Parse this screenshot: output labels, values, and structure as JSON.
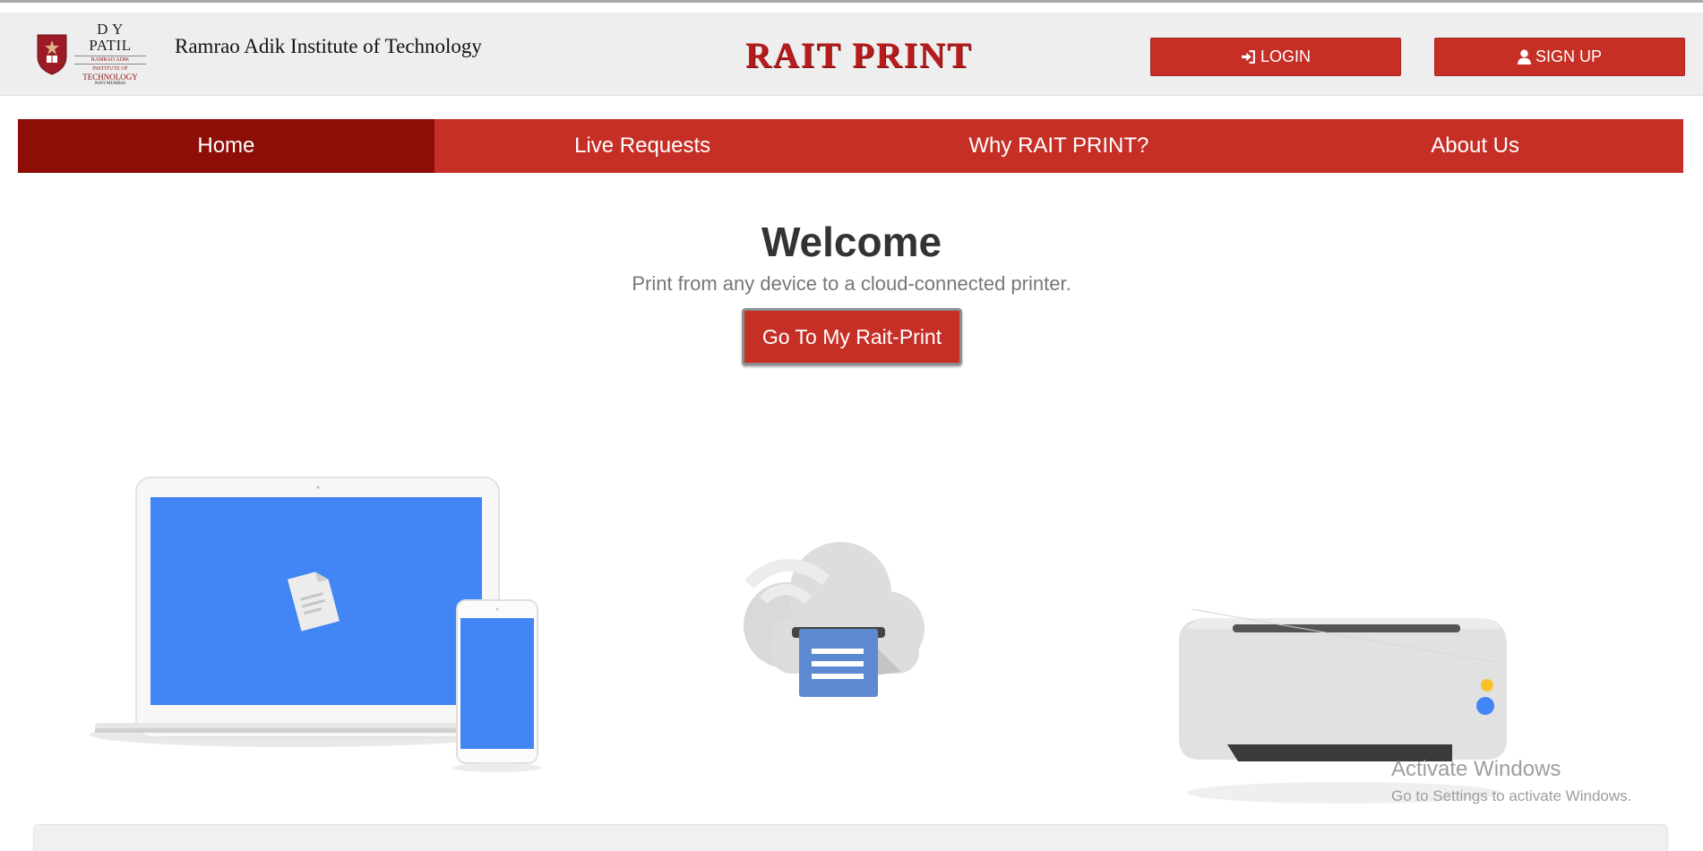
{
  "header": {
    "logo": {
      "line1": "D Y PATIL",
      "line2": "RAMRAO ADIK",
      "line3": "INSTITUTE OF",
      "line4": "TECHNOLOGY",
      "line5": "NAVI MUMBAI"
    },
    "institute_name": "Ramrao Adik Institute of Technology",
    "brand": "RAIT PRINT",
    "login_label": "LOGIN",
    "signup_label": "SIGN UP",
    "login_icon": "sign-in-icon",
    "signup_icon": "user-icon"
  },
  "nav": {
    "items": [
      {
        "label": "Home",
        "active": true
      },
      {
        "label": "Live Requests",
        "active": false
      },
      {
        "label": "Why RAIT PRINT?",
        "active": false
      },
      {
        "label": "About Us",
        "active": false
      }
    ]
  },
  "hero": {
    "title": "Welcome",
    "subtitle": "Print from any device to a cloud-connected printer.",
    "cta_label": "Go To My Rait-Print"
  },
  "watermark": {
    "title": "Activate Windows",
    "subtitle": "Go to Settings to activate Windows."
  },
  "colors": {
    "primary": "#c62f26",
    "nav_active": "#8c0e07",
    "brand_text": "#b71c1c",
    "header_bg": "#eeeeee",
    "device_screen": "#4285f4"
  }
}
